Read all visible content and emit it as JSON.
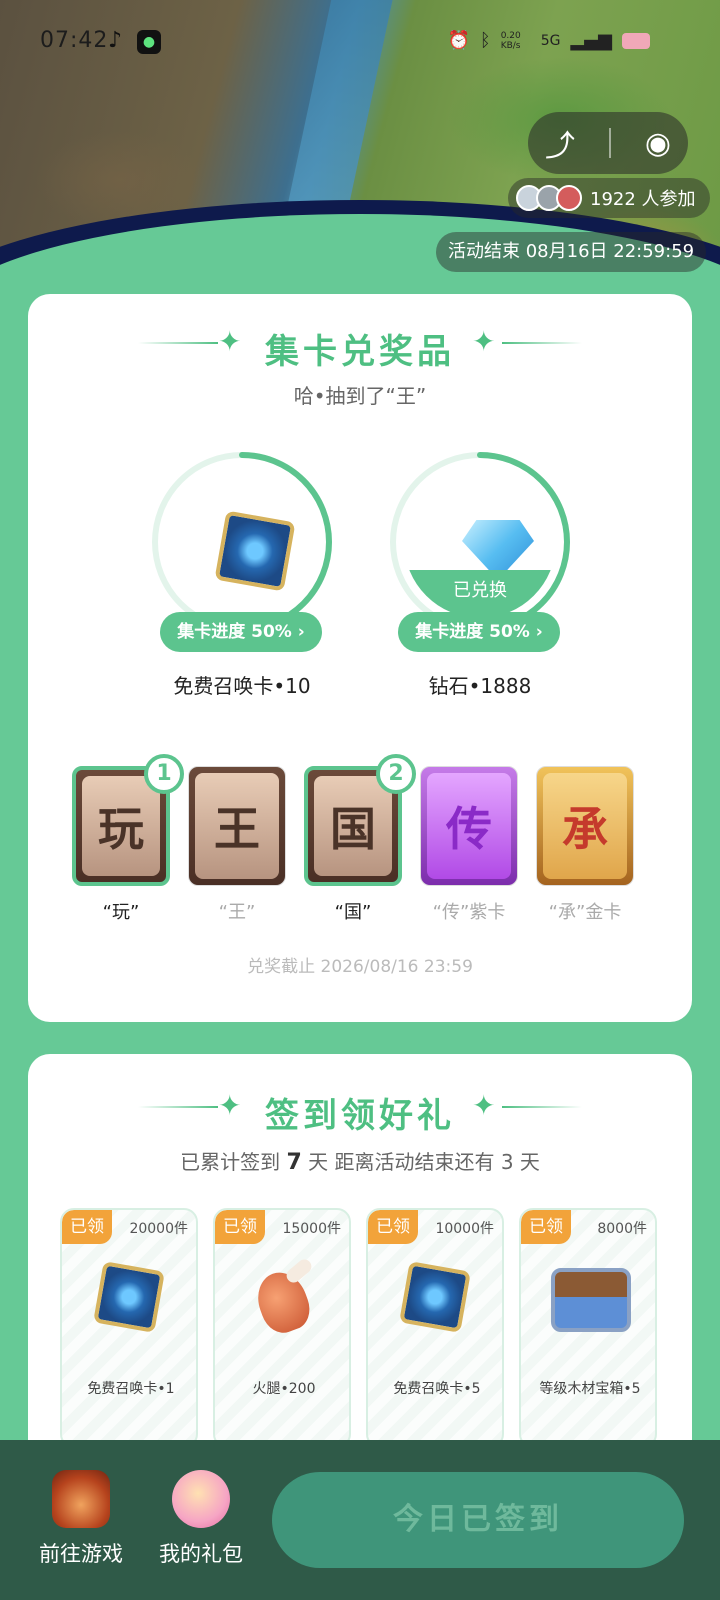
{
  "status_bar": {
    "time": "07:42",
    "network": "5G",
    "speed": "0.20 KB/s"
  },
  "hero": {
    "participants_text": "1922 人参加",
    "end_time_text": "活动结束 08月16日 22:59:59"
  },
  "collect": {
    "title": "集卡兑奖品",
    "subtitle": "哈•抽到了“王”",
    "prizes": [
      {
        "name": "免费召唤卡•10",
        "progress_label": "集卡进度 50%",
        "progress": 0.5,
        "redeemed_label": ""
      },
      {
        "name": "钻石•1888",
        "progress_label": "集卡进度 50%",
        "progress": 0.5,
        "redeemed_label": "已兑换"
      }
    ],
    "cards": [
      {
        "char": "玩",
        "label": "“玩”",
        "count": "1",
        "owned": true
      },
      {
        "char": "王",
        "label": "“王”",
        "count": "",
        "owned": false
      },
      {
        "char": "国",
        "label": "“国”",
        "count": "2",
        "owned": true
      },
      {
        "char": "传",
        "label": "“传”紫卡",
        "count": "",
        "owned": false
      },
      {
        "char": "承",
        "label": "“承”金卡",
        "count": "",
        "owned": false
      }
    ],
    "deadline": "兑奖截止 2026/08/16 23:59"
  },
  "signin": {
    "title": "签到领好礼",
    "subtitle_prefix": "已累计签到",
    "days": "7",
    "subtitle_suffix": "天 距离活动结束还有 3 天",
    "gifts": [
      {
        "tag": "已领",
        "count": "20000件",
        "name": "免费召唤卡•1",
        "icon": "summon-card-icon"
      },
      {
        "tag": "已领",
        "count": "15000件",
        "name": "火腿•200",
        "icon": "ham-icon"
      },
      {
        "tag": "已领",
        "count": "10000件",
        "name": "免费召唤卡•5",
        "icon": "summon-card-icon"
      },
      {
        "tag": "已领",
        "count": "8000件",
        "name": "等级木材宝箱•5",
        "icon": "treasure-chest-icon"
      }
    ]
  },
  "bottom_bar": {
    "go_game": "前往游戏",
    "my_gifts": "我的礼包",
    "signed_button": "今日已签到"
  },
  "colors": {
    "accent": "#5cc48e",
    "tag": "#f2a33a",
    "bottom": "#2f5a48"
  }
}
